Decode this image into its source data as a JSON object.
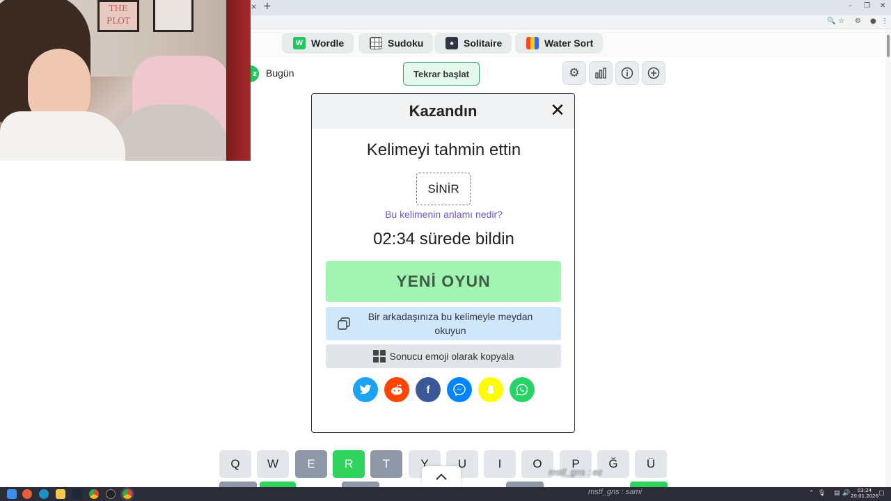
{
  "browser": {
    "tab_close": "×",
    "new_tab": "+",
    "window_controls": [
      "–",
      "❐",
      "✕"
    ]
  },
  "nav": {
    "items": [
      {
        "label": "Wordle",
        "icon": "W"
      },
      {
        "label": "Sudoku",
        "icon": ""
      },
      {
        "label": "Solitaire",
        "icon": ""
      },
      {
        "label": "Water Sort",
        "icon": ""
      }
    ]
  },
  "topbar": {
    "day_badge": "z",
    "today_label": "Bugün",
    "restart_label": "Tekrar başlat",
    "tools": [
      "gear-icon",
      "stats-icon",
      "info-icon",
      "plus-icon"
    ]
  },
  "webcam": {
    "poster_text": "THE PLOT"
  },
  "modal": {
    "title": "Kazandın",
    "close": "✕",
    "guessed_text": "Kelimeyi tahmin ettin",
    "word": "SİNİR",
    "meaning_link": "Bu kelimenin anlamı nedir?",
    "time_text": "02:34 sürede bildin",
    "new_game_label": "YENİ OYUN",
    "challenge_label": "Bir arkadaşınıza bu kelimeyle meydan okuyun",
    "emoji_copy_label": "Sonucu emoji olarak kopyala",
    "social": [
      {
        "name": "twitter",
        "glyph": "t",
        "color": "#1da1f2"
      },
      {
        "name": "reddit",
        "glyph": "r",
        "color": "#ff4500"
      },
      {
        "name": "facebook",
        "glyph": "f",
        "color": "#3b5998"
      },
      {
        "name": "messenger",
        "glyph": "m",
        "color": "#0084ff"
      },
      {
        "name": "snapchat",
        "glyph": "s",
        "color": "#fffc00"
      },
      {
        "name": "whatsapp",
        "glyph": "w",
        "color": "#25d366"
      }
    ]
  },
  "keyboard": {
    "row1": [
      {
        "key": "Q",
        "state": "empty"
      },
      {
        "key": "W",
        "state": "empty"
      },
      {
        "key": "E",
        "state": "absent"
      },
      {
        "key": "R",
        "state": "correct"
      },
      {
        "key": "T",
        "state": "absent"
      },
      {
        "key": "Y",
        "state": "empty"
      },
      {
        "key": "U",
        "state": "empty"
      },
      {
        "key": "I",
        "state": "empty"
      },
      {
        "key": "O",
        "state": "empty"
      },
      {
        "key": "P",
        "state": "empty"
      },
      {
        "key": "Ğ",
        "state": "empty"
      },
      {
        "key": "Ü",
        "state": "empty"
      }
    ],
    "collapse_icon": "⌃"
  },
  "overlay": {
    "chat_line": "mstf_gns : ez",
    "chat_line_2": "mstf_gns : sami"
  },
  "taskbar": {
    "clock_time": "03:24",
    "clock_date": "20.01.2026"
  },
  "colors": {
    "correct": "#2fd35e",
    "absent": "#8d97a5",
    "new_game": "#a3f4b2",
    "challenge": "#cfe6fb"
  }
}
